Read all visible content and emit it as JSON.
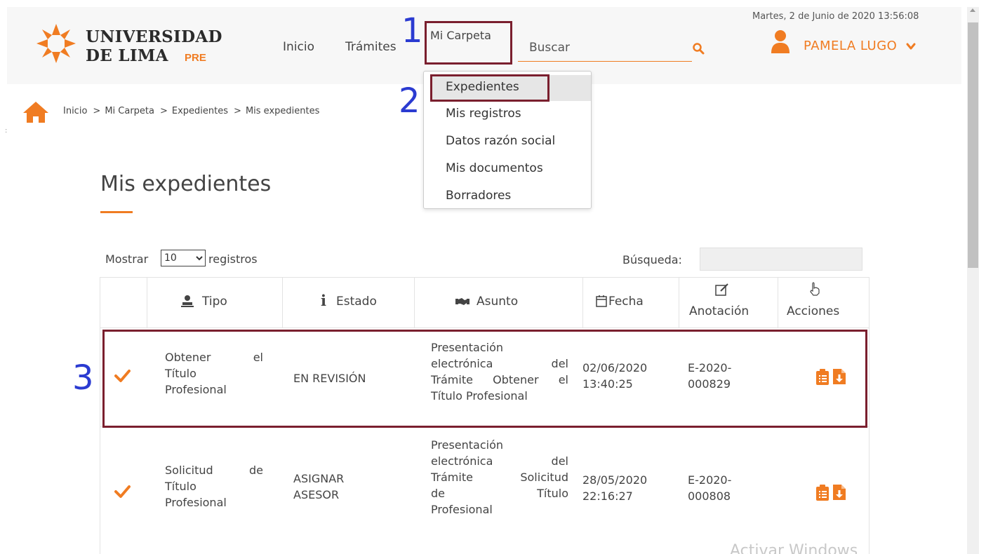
{
  "header": {
    "logo_line1": "UNIVERSIDAD",
    "logo_line2": "DE LIMA",
    "logo_badge": "PRE",
    "nav": {
      "inicio": "Inicio",
      "tramites": "Trámites",
      "mi_carpeta": "Mi Carpeta"
    },
    "search_placeholder": "Buscar",
    "datetime": "Martes, 2 de Junio de 2020 13:56:08",
    "user_name": "PAMELA LUGO"
  },
  "annotations": {
    "one": "1",
    "two": "2",
    "three": "3"
  },
  "dropdown": {
    "items": [
      "Expedientes",
      "Mis registros",
      "Datos razón social",
      "Mis documentos",
      "Borradores"
    ],
    "selected_index": 0
  },
  "breadcrumb": {
    "items": [
      "Inicio",
      "Mi Carpeta",
      "Expedientes",
      "Mis expedientes"
    ],
    "separator": ">"
  },
  "page": {
    "title": "Mis expedientes"
  },
  "table_controls": {
    "show_label": "Mostrar",
    "show_value": "10",
    "records_label": "registros",
    "search_label": "Búsqueda:"
  },
  "table": {
    "columns": [
      {
        "label": ""
      },
      {
        "label": "Tipo",
        "icon": "user-icon"
      },
      {
        "label": "Estado",
        "icon": "info-icon"
      },
      {
        "label": "Asunto",
        "icon": "handshake-icon"
      },
      {
        "label": "Fecha",
        "icon": "calendar-icon"
      },
      {
        "label": "Anotación",
        "icon": "edit-icon"
      },
      {
        "label": "Acciones",
        "icon": "hand-pointer-icon"
      }
    ],
    "rows": [
      {
        "tipo": [
          "Obtener",
          "el",
          "Título",
          "Profesional"
        ],
        "estado": "EN REVISIÓN",
        "asunto": [
          "Presentación",
          "electrónica del",
          "Trámite Obtener el",
          "Título Profesional"
        ],
        "fecha": [
          "02/06/2020",
          "13:40:25"
        ],
        "anotacion": [
          "E-2020-",
          "000829"
        ]
      },
      {
        "tipo": [
          "Solicitud",
          "de",
          "Título",
          "Profesional"
        ],
        "estado": [
          "ASIGNAR",
          "ASESOR"
        ],
        "asunto": [
          "Presentación",
          "electrónica del",
          "Trámite Solicitud",
          "de Título",
          "Profesional"
        ],
        "fecha": [
          "28/05/2020",
          "22:16:27"
        ],
        "anotacion": [
          "E-2020-",
          "000808"
        ]
      }
    ]
  },
  "colors": {
    "accent": "#f07c22",
    "annotation_box": "#7a1f2e",
    "annotation_number": "#2b3bd1"
  },
  "watermark": "Activar Windows"
}
